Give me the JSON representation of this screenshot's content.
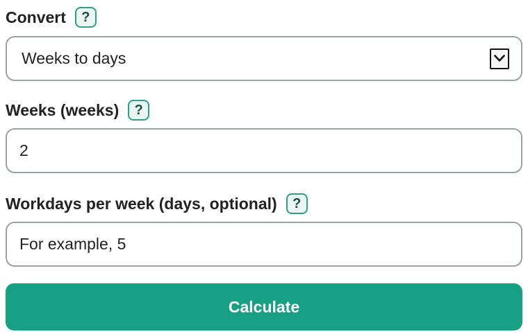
{
  "convert": {
    "label": "Convert",
    "help_label": "?",
    "selected": "Weeks to days",
    "dropdown_icon": "chevron-down-icon"
  },
  "weeks": {
    "label": "Weeks (weeks)",
    "help_label": "?",
    "value": "2"
  },
  "workdays": {
    "label": "Workdays per week (days, optional)",
    "help_label": "?",
    "placeholder": "For example, 5",
    "value": ""
  },
  "calculate": {
    "label": "Calculate"
  },
  "colors": {
    "accent": "#18a085",
    "help_border": "#2f9e86",
    "help_background": "#e9f5f1",
    "field_border": "#9aa3a1"
  }
}
